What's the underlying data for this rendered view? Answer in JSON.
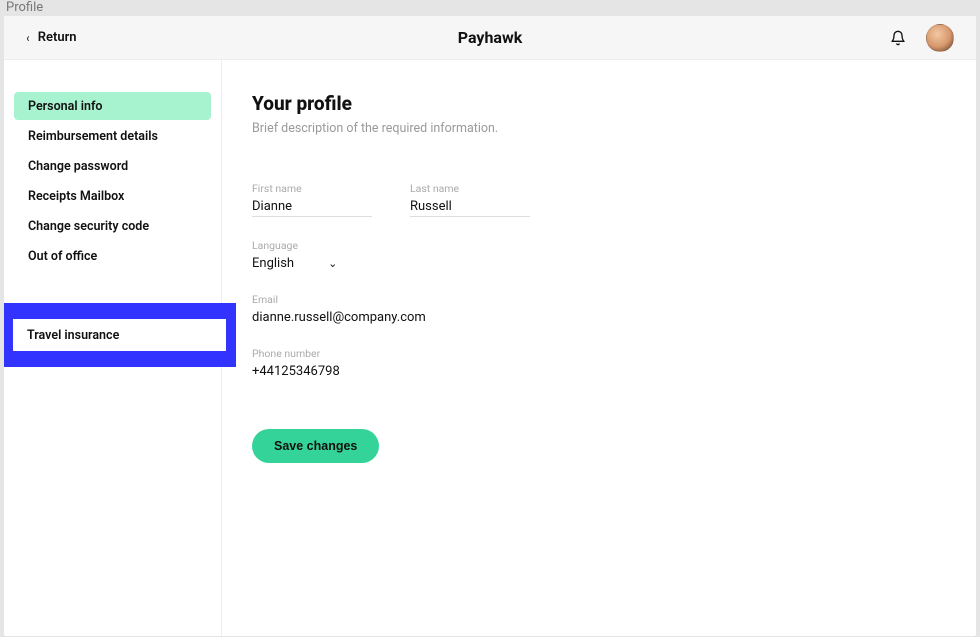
{
  "browser": {
    "tab_title": "Profile"
  },
  "header": {
    "return_label": "Return",
    "brand": "Payhawk"
  },
  "sidebar": {
    "items": [
      {
        "label": "Personal info",
        "active": true
      },
      {
        "label": "Reimbursement details",
        "active": false
      },
      {
        "label": "Change password",
        "active": false
      },
      {
        "label": "Receipts Mailbox",
        "active": false
      },
      {
        "label": "Change security code",
        "active": false
      },
      {
        "label": "Out of office",
        "active": false
      }
    ],
    "highlighted_item": {
      "label": "Travel insurance"
    }
  },
  "main": {
    "title": "Your profile",
    "description": "Brief description of the required information.",
    "fields": {
      "first_name": {
        "label": "First name",
        "value": "Dianne"
      },
      "last_name": {
        "label": "Last name",
        "value": "Russell"
      },
      "language": {
        "label": "Language",
        "value": "English"
      },
      "email": {
        "label": "Email",
        "value": "dianne.russell@company.com"
      },
      "phone": {
        "label": "Phone number",
        "value": "+44125346798"
      }
    },
    "save_label": "Save changes"
  },
  "colors": {
    "accent": "#34d399",
    "highlight": "#3333ff",
    "sidebar_active": "#a7f3d0"
  }
}
